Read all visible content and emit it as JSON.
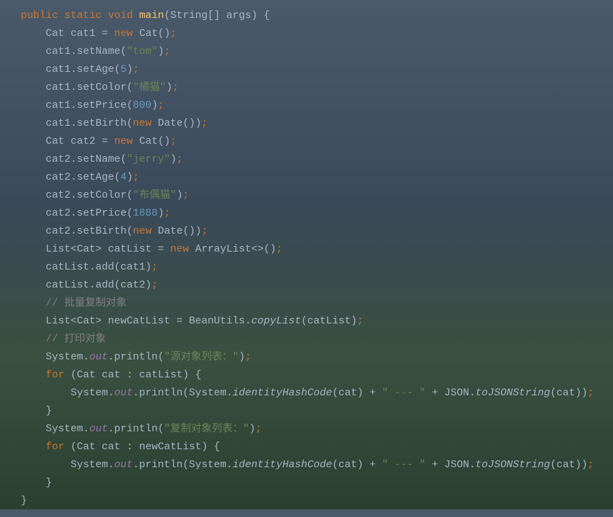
{
  "code": {
    "lines": [
      {
        "indent": 0,
        "tokens": [
          {
            "t": "kw",
            "v": "public"
          },
          {
            "t": "sp",
            "v": " "
          },
          {
            "t": "kw",
            "v": "static"
          },
          {
            "t": "sp",
            "v": " "
          },
          {
            "t": "kw",
            "v": "void"
          },
          {
            "t": "sp",
            "v": " "
          },
          {
            "t": "method",
            "v": "main"
          },
          {
            "t": "paren",
            "v": "(String[] args) {"
          }
        ]
      },
      {
        "indent": 1,
        "tokens": [
          {
            "t": "ident",
            "v": "Cat cat1 = "
          },
          {
            "t": "kw",
            "v": "new"
          },
          {
            "t": "sp",
            "v": " "
          },
          {
            "t": "ident",
            "v": "Cat()"
          },
          {
            "t": "semi",
            "v": ";"
          }
        ]
      },
      {
        "indent": 1,
        "tokens": [
          {
            "t": "ident",
            "v": "cat1.setName("
          },
          {
            "t": "str",
            "v": "\"tom\""
          },
          {
            "t": "ident",
            "v": ")"
          },
          {
            "t": "semi",
            "v": ";"
          }
        ]
      },
      {
        "indent": 1,
        "tokens": [
          {
            "t": "ident",
            "v": "cat1.setAge("
          },
          {
            "t": "num",
            "v": "5"
          },
          {
            "t": "ident",
            "v": ")"
          },
          {
            "t": "semi",
            "v": ";"
          }
        ]
      },
      {
        "indent": 1,
        "tokens": [
          {
            "t": "ident",
            "v": "cat1.setColor("
          },
          {
            "t": "str",
            "v": "\"橘猫\""
          },
          {
            "t": "ident",
            "v": ")"
          },
          {
            "t": "semi",
            "v": ";"
          }
        ]
      },
      {
        "indent": 1,
        "tokens": [
          {
            "t": "ident",
            "v": "cat1.setPrice("
          },
          {
            "t": "num",
            "v": "800"
          },
          {
            "t": "ident",
            "v": ")"
          },
          {
            "t": "semi",
            "v": ";"
          }
        ]
      },
      {
        "indent": 1,
        "tokens": [
          {
            "t": "ident",
            "v": "cat1.setBirth("
          },
          {
            "t": "kw",
            "v": "new"
          },
          {
            "t": "sp",
            "v": " "
          },
          {
            "t": "ident",
            "v": "Date())"
          },
          {
            "t": "semi",
            "v": ";"
          }
        ]
      },
      {
        "indent": 1,
        "tokens": [
          {
            "t": "ident",
            "v": "Cat cat2 = "
          },
          {
            "t": "kw",
            "v": "new"
          },
          {
            "t": "sp",
            "v": " "
          },
          {
            "t": "ident",
            "v": "Cat()"
          },
          {
            "t": "semi",
            "v": ";"
          }
        ]
      },
      {
        "indent": 1,
        "tokens": [
          {
            "t": "ident",
            "v": "cat2.setName("
          },
          {
            "t": "str",
            "v": "\"jerry\""
          },
          {
            "t": "ident",
            "v": ")"
          },
          {
            "t": "semi",
            "v": ";"
          }
        ]
      },
      {
        "indent": 1,
        "tokens": [
          {
            "t": "ident",
            "v": "cat2.setAge("
          },
          {
            "t": "num",
            "v": "4"
          },
          {
            "t": "ident",
            "v": ")"
          },
          {
            "t": "semi",
            "v": ";"
          }
        ]
      },
      {
        "indent": 1,
        "tokens": [
          {
            "t": "ident",
            "v": "cat2.setColor("
          },
          {
            "t": "str",
            "v": "\"布偶猫\""
          },
          {
            "t": "ident",
            "v": ")"
          },
          {
            "t": "semi",
            "v": ";"
          }
        ]
      },
      {
        "indent": 1,
        "tokens": [
          {
            "t": "ident",
            "v": "cat2.setPrice("
          },
          {
            "t": "num",
            "v": "1888"
          },
          {
            "t": "ident",
            "v": ")"
          },
          {
            "t": "semi",
            "v": ";"
          }
        ]
      },
      {
        "indent": 1,
        "tokens": [
          {
            "t": "ident",
            "v": "cat2.setBirth("
          },
          {
            "t": "kw",
            "v": "new"
          },
          {
            "t": "sp",
            "v": " "
          },
          {
            "t": "ident",
            "v": "Date())"
          },
          {
            "t": "semi",
            "v": ";"
          }
        ]
      },
      {
        "indent": 1,
        "tokens": [
          {
            "t": "ident",
            "v": "List<Cat> catList = "
          },
          {
            "t": "kw",
            "v": "new"
          },
          {
            "t": "sp",
            "v": " "
          },
          {
            "t": "ident",
            "v": "ArrayList<>()"
          },
          {
            "t": "semi",
            "v": ";"
          }
        ]
      },
      {
        "indent": 1,
        "tokens": [
          {
            "t": "ident",
            "v": "catList.add(cat1)"
          },
          {
            "t": "semi",
            "v": ";"
          }
        ]
      },
      {
        "indent": 1,
        "tokens": [
          {
            "t": "ident",
            "v": "catList.add(cat2)"
          },
          {
            "t": "semi",
            "v": ";"
          }
        ]
      },
      {
        "indent": 1,
        "tokens": [
          {
            "t": "comment",
            "v": "// 批量复制对象"
          }
        ]
      },
      {
        "indent": 1,
        "tokens": [
          {
            "t": "ident",
            "v": "List<Cat> newCatList = BeanUtils."
          },
          {
            "t": "static-method",
            "v": "copyList"
          },
          {
            "t": "ident",
            "v": "(catList)"
          },
          {
            "t": "semi",
            "v": ";"
          }
        ]
      },
      {
        "indent": 1,
        "tokens": [
          {
            "t": "comment",
            "v": "// 打印对象"
          }
        ]
      },
      {
        "indent": 1,
        "tokens": [
          {
            "t": "ident",
            "v": "System."
          },
          {
            "t": "field",
            "v": "out"
          },
          {
            "t": "ident",
            "v": ".println("
          },
          {
            "t": "str",
            "v": "\"源对象列表：\""
          },
          {
            "t": "ident",
            "v": ")"
          },
          {
            "t": "semi",
            "v": ";"
          }
        ]
      },
      {
        "indent": 1,
        "tokens": [
          {
            "t": "kw",
            "v": "for"
          },
          {
            "t": "sp",
            "v": " "
          },
          {
            "t": "ident",
            "v": "(Cat cat : catList) {"
          }
        ]
      },
      {
        "indent": 2,
        "tokens": [
          {
            "t": "ident",
            "v": "System."
          },
          {
            "t": "field",
            "v": "out"
          },
          {
            "t": "ident",
            "v": ".println(System."
          },
          {
            "t": "static-method",
            "v": "identityHashCode"
          },
          {
            "t": "ident",
            "v": "(cat) + "
          },
          {
            "t": "str",
            "v": "\" --- \""
          },
          {
            "t": "ident",
            "v": " + JSON."
          },
          {
            "t": "static-method",
            "v": "toJSONString"
          },
          {
            "t": "ident",
            "v": "(cat))"
          },
          {
            "t": "semi",
            "v": ";"
          }
        ]
      },
      {
        "indent": 1,
        "tokens": [
          {
            "t": "ident",
            "v": "}"
          }
        ]
      },
      {
        "indent": 1,
        "tokens": [
          {
            "t": "ident",
            "v": "System."
          },
          {
            "t": "field",
            "v": "out"
          },
          {
            "t": "ident",
            "v": ".println("
          },
          {
            "t": "str",
            "v": "\"复制对象列表：\""
          },
          {
            "t": "ident",
            "v": ")"
          },
          {
            "t": "semi",
            "v": ";"
          }
        ]
      },
      {
        "indent": 1,
        "tokens": [
          {
            "t": "kw",
            "v": "for"
          },
          {
            "t": "sp",
            "v": " "
          },
          {
            "t": "ident",
            "v": "(Cat cat : newCatList) {"
          }
        ]
      },
      {
        "indent": 2,
        "tokens": [
          {
            "t": "ident",
            "v": "System."
          },
          {
            "t": "field",
            "v": "out"
          },
          {
            "t": "ident",
            "v": ".println(System."
          },
          {
            "t": "static-method",
            "v": "identityHashCode"
          },
          {
            "t": "ident",
            "v": "(cat) + "
          },
          {
            "t": "str",
            "v": "\" --- \""
          },
          {
            "t": "ident",
            "v": " + JSON."
          },
          {
            "t": "static-method",
            "v": "toJSONString"
          },
          {
            "t": "ident",
            "v": "(cat))"
          },
          {
            "t": "semi",
            "v": ";"
          }
        ]
      },
      {
        "indent": 1,
        "tokens": [
          {
            "t": "ident",
            "v": "}"
          }
        ]
      },
      {
        "indent": 0,
        "tokens": [
          {
            "t": "ident",
            "v": "}"
          }
        ]
      }
    ]
  }
}
